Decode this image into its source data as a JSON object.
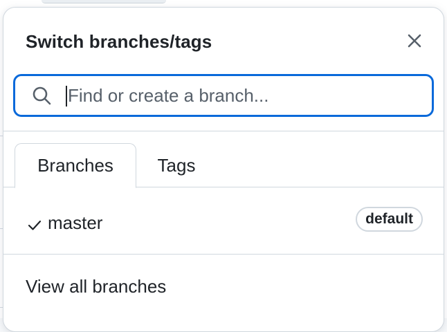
{
  "popover": {
    "title": "Switch branches/tags",
    "close_icon": "close-icon"
  },
  "search": {
    "placeholder": "Find or create a branch...",
    "value": "",
    "icon": "search-icon",
    "focus_color": "#0969da"
  },
  "tabs": [
    {
      "label": "Branches",
      "selected": true
    },
    {
      "label": "Tags",
      "selected": false
    }
  ],
  "branches": [
    {
      "name": "master",
      "checked": true,
      "badge": "default",
      "icon": "check-icon"
    }
  ],
  "footer": {
    "view_all_label": "View all branches"
  }
}
